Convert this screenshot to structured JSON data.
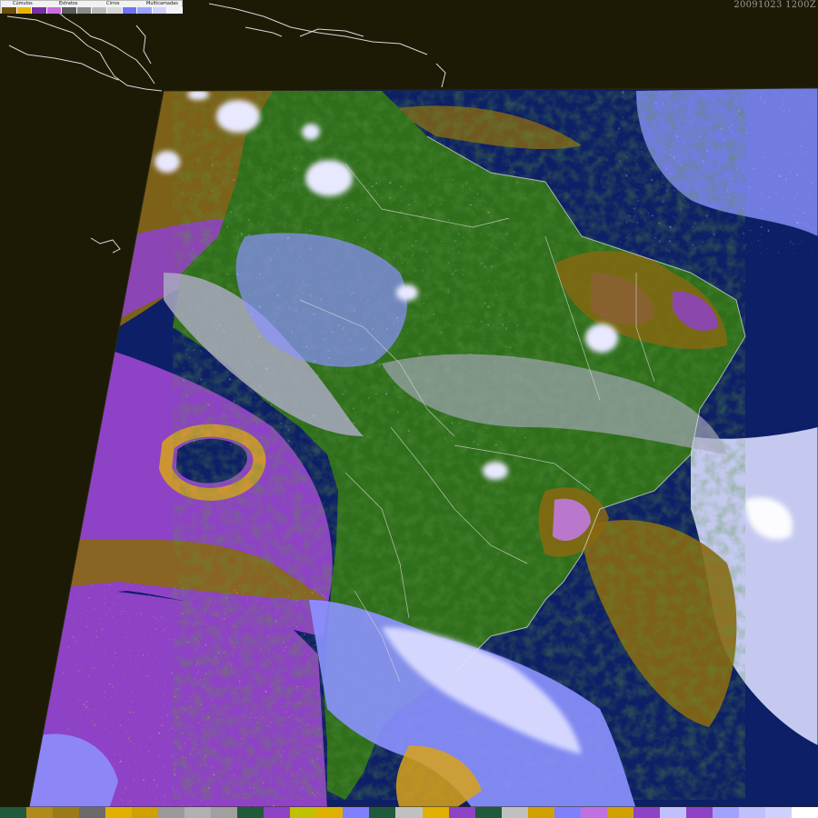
{
  "timestamp": "20091023 1200Z",
  "legend": {
    "labels": [
      "Cúmulos",
      "Estratos",
      "Cirros",
      "Multicamadas"
    ],
    "swatches": [
      "#6b4f0a",
      "#e6b400",
      "#7a2fa6",
      "#c86ee0",
      "#5b5b5b",
      "#8a8a8a",
      "#b9b9b9",
      "#d6d6d6",
      "#6f74f2",
      "#9fa3ff",
      "#cfd1ff",
      "#f2f2ff"
    ]
  },
  "colors": {
    "space": "#1c1a05",
    "ocean": "#0d1f66",
    "land": "#2f6e1b",
    "land_dark": "#1f4f12",
    "cumulus_dark": "#8a6810",
    "cumulus": "#d8a21a",
    "stratus": "#8e42c6",
    "stratus_light": "#c07ae0",
    "cirrus": "#a9a9bf",
    "multi": "#8c92ff",
    "multi_light": "#d9dbff",
    "coast": "#e0e0e0"
  },
  "palette_bar": [
    "#1f5a3a",
    "#b08a1a",
    "#9a7a1a",
    "#6b6b6b",
    "#e0b000",
    "#d0a000",
    "#9a9a9a",
    "#b0b0b0",
    "#a0a0a0",
    "#1f5a3a",
    "#8e42c6",
    "#c0c000",
    "#e0b000",
    "#8080ff",
    "#1f5a3a",
    "#c0c0c0",
    "#e0b000",
    "#8e42c6",
    "#1f5a3a",
    "#c0c0c0",
    "#d0a000",
    "#8080ff",
    "#c070e0",
    "#d0a000",
    "#8e42c6",
    "#c0c0ff",
    "#8e42c6",
    "#a0a0ff",
    "#c0c0ff",
    "#d0d0ff",
    "#ffffff"
  ]
}
